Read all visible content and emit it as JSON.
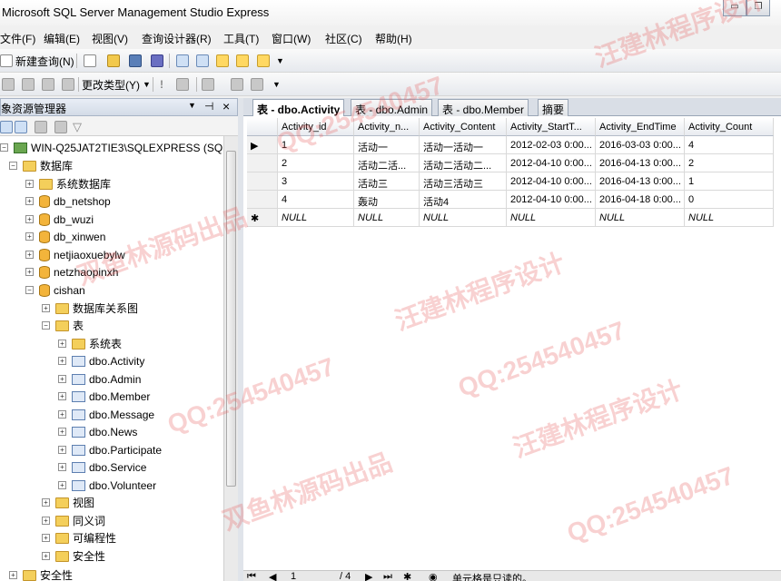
{
  "window": {
    "title": "Microsoft SQL Server Management Studio Express",
    "minimize": "▭",
    "restore": "❐"
  },
  "menu": [
    "文件(F)",
    "编辑(E)",
    "视图(V)",
    "查询设计器(R)",
    "工具(T)",
    "窗口(W)",
    "社区(C)",
    "帮助(H)"
  ],
  "toolbar": {
    "new_query": "新建查询(N)",
    "change_type": "更改类型(Y)"
  },
  "object_explorer": {
    "title": "象资源管理器",
    "pin": "⊣",
    "close": "×",
    "tree": [
      {
        "label": "WIN-Q25JAT2TIE3\\SQLEXPRESS (SQL",
        "icon": "server-icon"
      },
      {
        "label": "数据库",
        "icon": "folder-icon"
      },
      {
        "label": "系统数据库",
        "icon": "folder-icon"
      },
      {
        "label": "db_netshop",
        "icon": "database-icon"
      },
      {
        "label": "db_wuzi",
        "icon": "database-icon"
      },
      {
        "label": "db_xinwen",
        "icon": "database-icon"
      },
      {
        "label": "netjiaoxuebylw",
        "icon": "database-icon"
      },
      {
        "label": "netzhaopinxh",
        "icon": "database-icon"
      },
      {
        "label": "cishan",
        "icon": "database-icon"
      },
      {
        "label": "数据库关系图",
        "icon": "folder-icon"
      },
      {
        "label": "表",
        "icon": "folder-icon"
      },
      {
        "label": "系统表",
        "icon": "folder-icon"
      },
      {
        "label": "dbo.Activity",
        "icon": "table-icon"
      },
      {
        "label": "dbo.Admin",
        "icon": "table-icon"
      },
      {
        "label": "dbo.Member",
        "icon": "table-icon"
      },
      {
        "label": "dbo.Message",
        "icon": "table-icon"
      },
      {
        "label": "dbo.News",
        "icon": "table-icon"
      },
      {
        "label": "dbo.Participate",
        "icon": "table-icon"
      },
      {
        "label": "dbo.Service",
        "icon": "table-icon"
      },
      {
        "label": "dbo.Volunteer",
        "icon": "table-icon"
      },
      {
        "label": "视图",
        "icon": "folder-icon"
      },
      {
        "label": "同义词",
        "icon": "folder-icon"
      },
      {
        "label": "可编程性",
        "icon": "folder-icon"
      },
      {
        "label": "安全性",
        "icon": "folder-icon"
      },
      {
        "label": "安全性",
        "icon": "folder-icon"
      }
    ]
  },
  "tabs": [
    {
      "label": "表 - dbo.Activity"
    },
    {
      "label": "表 - dbo.Admin"
    },
    {
      "label": "表 - dbo.Member"
    },
    {
      "label": "摘要"
    }
  ],
  "grid": {
    "columns": [
      "Activity_id",
      "Activity_n...",
      "Activity_Content",
      "Activity_StartT...",
      "Activity_EndTime",
      "Activity_Count"
    ],
    "rows": [
      [
        "1",
        "活动一",
        "活动一活动一",
        "2012-02-03 0:00...",
        "2016-03-03 0:00...",
        "4"
      ],
      [
        "2",
        "活动二活...",
        "活动二活动二...",
        "2012-04-10 0:00...",
        "2016-04-13 0:00...",
        "2"
      ],
      [
        "3",
        "活动三",
        "活动三活动三",
        "2012-04-10 0:00...",
        "2016-04-13 0:00...",
        "1"
      ],
      [
        "4",
        "轰动",
        "活动4",
        "2012-04-10 0:00...",
        "2016-04-18 0:00...",
        "0"
      ],
      [
        "NULL",
        "NULL",
        "NULL",
        "NULL",
        "NULL",
        "NULL"
      ]
    ],
    "current_row_marker": "▶",
    "new_row_marker": "✱"
  },
  "navigation": {
    "current": "1",
    "total": "/ 4",
    "status": "单元格是只读的。"
  },
  "watermark": {
    "lines": [
      "汪建林程序设计",
      "QQ:254540457",
      "双鱼林源码出品"
    ]
  }
}
